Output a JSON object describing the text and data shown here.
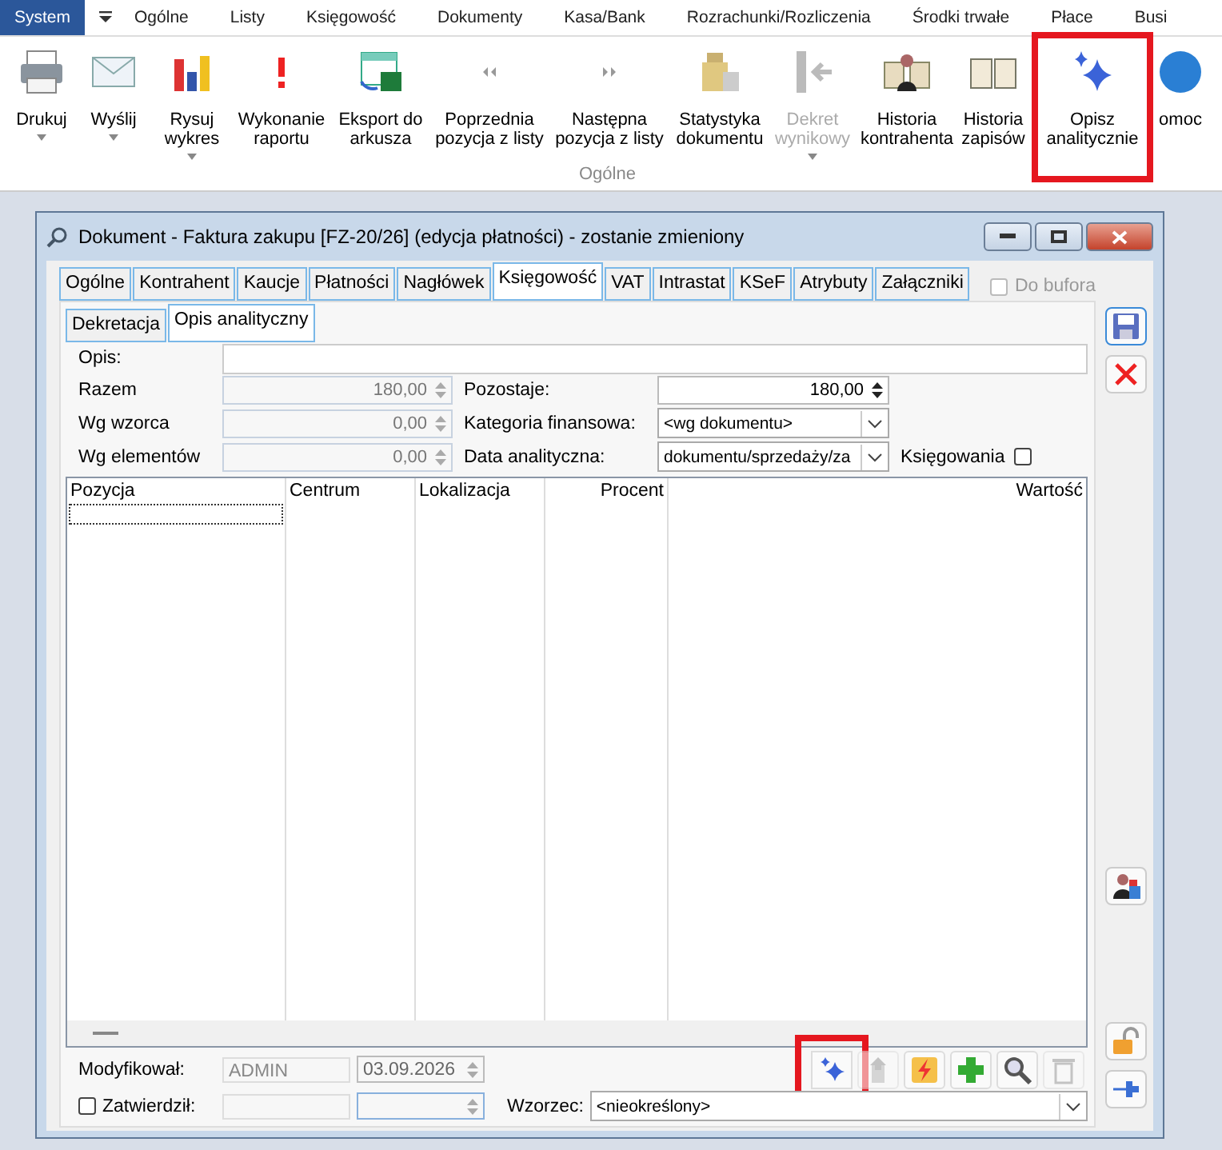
{
  "menu": {
    "items": [
      {
        "label": "System",
        "selected": true
      },
      {
        "label": "Ogólne",
        "selected": false
      },
      {
        "label": "Listy",
        "selected": false
      },
      {
        "label": "Księgowość",
        "selected": false
      },
      {
        "label": "Dokumenty",
        "selected": false
      },
      {
        "label": "Kasa/Bank",
        "selected": false
      },
      {
        "label": "Rozrachunki/Rozliczenia",
        "selected": false
      },
      {
        "label": "Środki trwałe",
        "selected": false
      },
      {
        "label": "Płace",
        "selected": false
      },
      {
        "label": "Busi",
        "selected": false
      }
    ]
  },
  "ribbon": {
    "group_label": "Ogólne",
    "buttons": [
      {
        "kind": "printer",
        "label": "Drukuj",
        "dropdown": true,
        "disabled": false,
        "highlighted": false
      },
      {
        "kind": "mail",
        "label": "Wyślij",
        "dropdown": true,
        "disabled": false,
        "highlighted": false
      },
      {
        "kind": "chart",
        "label": "Rysuj wykres",
        "dropdown": true,
        "disabled": false,
        "highlighted": false
      },
      {
        "kind": "alert",
        "label": "Wykonanie raportu",
        "dropdown": false,
        "disabled": false,
        "highlighted": false
      },
      {
        "kind": "sheet",
        "label": "Eksport do arkusza",
        "dropdown": false,
        "disabled": false,
        "highlighted": false
      },
      {
        "kind": "prev",
        "label": "Poprzednia pozycja z listy",
        "dropdown": false,
        "disabled": false,
        "highlighted": false
      },
      {
        "kind": "next",
        "label": "Następna pozycja z listy",
        "dropdown": false,
        "disabled": false,
        "highlighted": false
      },
      {
        "kind": "weights",
        "label": "Statystyka dokumentu",
        "dropdown": false,
        "disabled": false,
        "highlighted": false
      },
      {
        "kind": "decree",
        "label": "Dekret wynikowy",
        "dropdown": true,
        "disabled": true,
        "highlighted": false
      },
      {
        "kind": "person-book",
        "label": "Historia kontrahenta",
        "dropdown": false,
        "disabled": false,
        "highlighted": false
      },
      {
        "kind": "book",
        "label": "Historia zapisów",
        "dropdown": false,
        "disabled": false,
        "highlighted": false
      },
      {
        "kind": "sparkle",
        "label": "Opisz analitycznie",
        "dropdown": false,
        "disabled": false,
        "highlighted": true
      },
      {
        "kind": "help",
        "label": "omoc",
        "dropdown": false,
        "disabled": false,
        "highlighted": false
      }
    ]
  },
  "dialog": {
    "title": "Dokument - Faktura zakupu [FZ-20/26] (edycja płatności) - zostanie zmieniony",
    "tabs": [
      {
        "label": "Ogólne",
        "selected": false
      },
      {
        "label": "Kontrahent",
        "selected": false
      },
      {
        "label": "Kaucje",
        "selected": false
      },
      {
        "label": "Płatności",
        "selected": false
      },
      {
        "label": "Nagłówek",
        "selected": false
      },
      {
        "label": "Księgowość",
        "selected": true
      },
      {
        "label": "VAT",
        "selected": false
      },
      {
        "label": "Intrastat",
        "selected": false
      },
      {
        "label": "KSeF",
        "selected": false
      },
      {
        "label": "Atrybuty",
        "selected": false
      },
      {
        "label": "Załączniki",
        "selected": false
      }
    ],
    "do_bufora": {
      "label": "Do bufora",
      "checked": false
    },
    "subtabs": [
      {
        "label": "Dekretacja",
        "selected": false
      },
      {
        "label": "Opis analityczny",
        "selected": true
      }
    ],
    "opis": {
      "label": "Opis:"
    },
    "razem": {
      "label": "Razem",
      "value": "180,00"
    },
    "wg_wzorca": {
      "label": "Wg wzorca",
      "value": "0,00"
    },
    "wg_elementow": {
      "label": "Wg elementów",
      "value": "0,00"
    },
    "pozostaje": {
      "label": "Pozostaje:",
      "value": "180,00"
    },
    "kategoria": {
      "label": "Kategoria finansowa:",
      "value": "<wg dokumentu>"
    },
    "data_analityczna": {
      "label": "Data analityczna:",
      "value": "dokumentu/sprzedaży/za"
    },
    "ksiegowania": {
      "label": "Księgowania",
      "checked": false
    },
    "table": {
      "columns": [
        {
          "label": "Pozycja"
        },
        {
          "label": "Centrum"
        },
        {
          "label": "Lokalizacja"
        },
        {
          "label": "Procent"
        },
        {
          "label": "Wartość"
        }
      ]
    },
    "modyfikowal": {
      "label": "Modyfikował:",
      "user": "ADMIN",
      "date": "03.09.2026"
    },
    "zatwierdzil": {
      "label": "Zatwierdził:",
      "checked": false
    },
    "wzorzec": {
      "label": "Wzorzec:",
      "value": "<nieokreślony>"
    },
    "tools": [
      {
        "kind": "sparkle",
        "disabled": false,
        "highlighted": true
      },
      {
        "kind": "export",
        "disabled": true,
        "highlighted": false
      },
      {
        "kind": "bolt",
        "disabled": false,
        "highlighted": false
      },
      {
        "kind": "plus",
        "disabled": false,
        "highlighted": false
      },
      {
        "kind": "search",
        "disabled": false,
        "highlighted": false
      },
      {
        "kind": "trash",
        "disabled": true,
        "highlighted": false
      }
    ],
    "side_tools": [
      {
        "kind": "save"
      },
      {
        "kind": "cancel"
      },
      {
        "kind": "person"
      },
      {
        "kind": "lock"
      },
      {
        "kind": "pin"
      }
    ]
  }
}
